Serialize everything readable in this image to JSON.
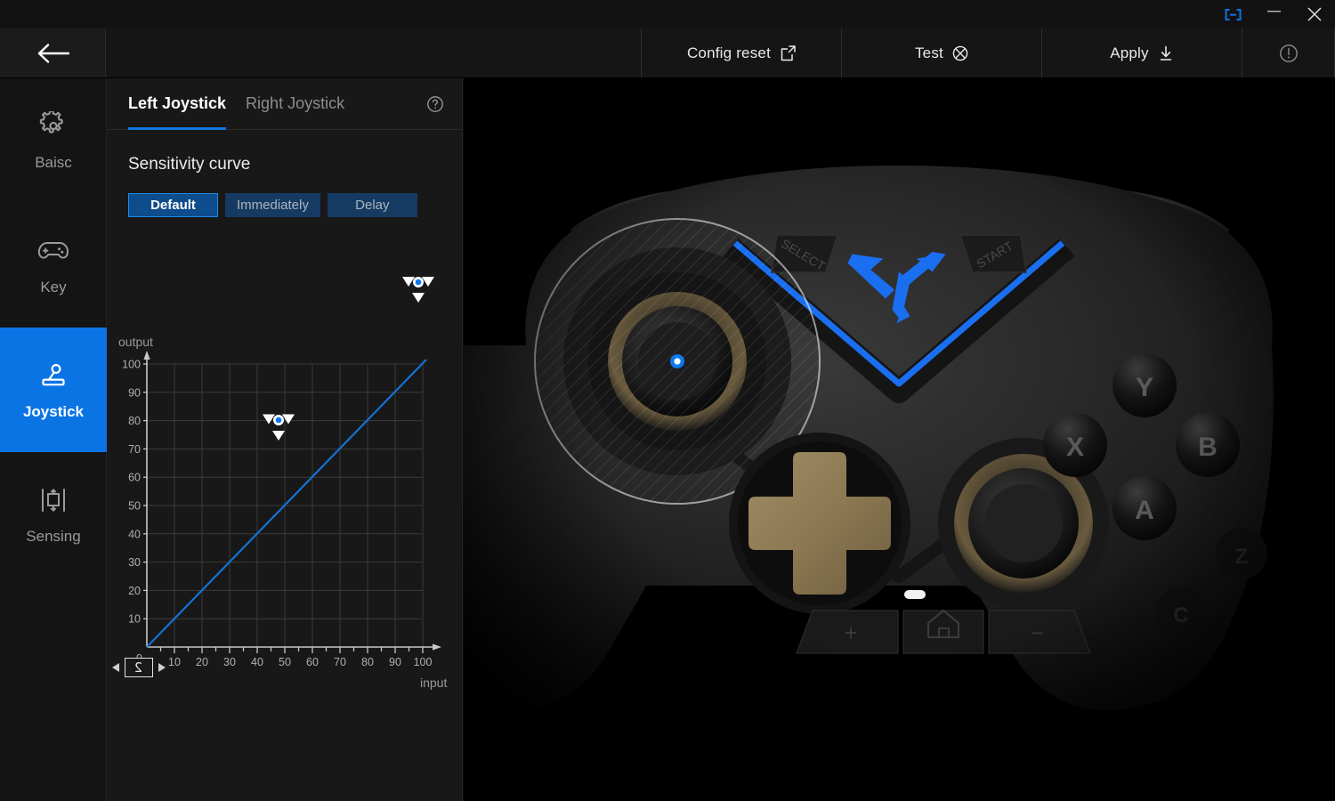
{
  "window": {
    "controls": [
      {
        "name": "connection-indicator",
        "glyph": "[-]"
      },
      {
        "name": "minimize",
        "glyph": "—"
      },
      {
        "name": "close",
        "glyph": "✕"
      }
    ]
  },
  "toolbar": {
    "back_label": "",
    "items": [
      {
        "label": "Config reset",
        "icon": "export-icon"
      },
      {
        "label": "Test",
        "icon": "test-circle-x-icon"
      },
      {
        "label": "Apply",
        "icon": "download-icon"
      }
    ],
    "info_label": ""
  },
  "sidebar": {
    "items": [
      {
        "label": "Baisc",
        "icon": "gear-icon",
        "active": false
      },
      {
        "label": "Key",
        "icon": "gamepad-icon",
        "active": false
      },
      {
        "label": "Joystick",
        "icon": "joystick-icon",
        "active": true
      },
      {
        "label": "Sensing",
        "icon": "sensing-icon",
        "active": false
      }
    ]
  },
  "panel": {
    "tabs": [
      {
        "label": "Left Joystick",
        "active": true
      },
      {
        "label": "Right Joystick",
        "active": false
      }
    ],
    "help_icon": "question-circle-icon",
    "section_title": "Sensitivity curve",
    "curve_modes": [
      {
        "label": "Default",
        "active": true
      },
      {
        "label": "Immediately",
        "active": false
      },
      {
        "label": "Delay",
        "active": false
      }
    ],
    "stepper": {
      "value": "2",
      "left_icon": "left-arrow-icon",
      "right_icon": "right-arrow-icon"
    }
  },
  "chart_data": {
    "type": "line",
    "title": "",
    "xlabel": "input",
    "ylabel": "output",
    "xlim": [
      0,
      105
    ],
    "ylim": [
      0,
      105
    ],
    "xticks": [
      0,
      10,
      20,
      30,
      40,
      50,
      60,
      70,
      80,
      90,
      100
    ],
    "yticks": [
      10,
      20,
      30,
      40,
      50,
      60,
      70,
      80,
      90,
      100
    ],
    "grid": true,
    "legend": "none",
    "line_color": "#1273d4",
    "series": [
      {
        "name": "Sensitivity",
        "x": [
          0,
          10,
          20,
          30,
          40,
          50,
          60,
          70,
          80,
          90,
          100
        ],
        "values": [
          0,
          10,
          20,
          30,
          40,
          50,
          60,
          70,
          80,
          90,
          100
        ]
      }
    ],
    "control_points": [
      {
        "x": 50,
        "y": 50
      },
      {
        "x": 100,
        "y": 100
      }
    ]
  },
  "controller": {
    "logo": "flydigi-logo",
    "select_label": "SELECT",
    "start_label": "START",
    "face_buttons": [
      "Y",
      "X",
      "B",
      "A",
      "Z",
      "C"
    ],
    "bottom_buttons": [
      "+",
      "home-icon",
      "−"
    ],
    "accent_color": "#1a6ff0",
    "dpad_color": "#8c7856",
    "left_stick_dot": "#0b79f0"
  }
}
